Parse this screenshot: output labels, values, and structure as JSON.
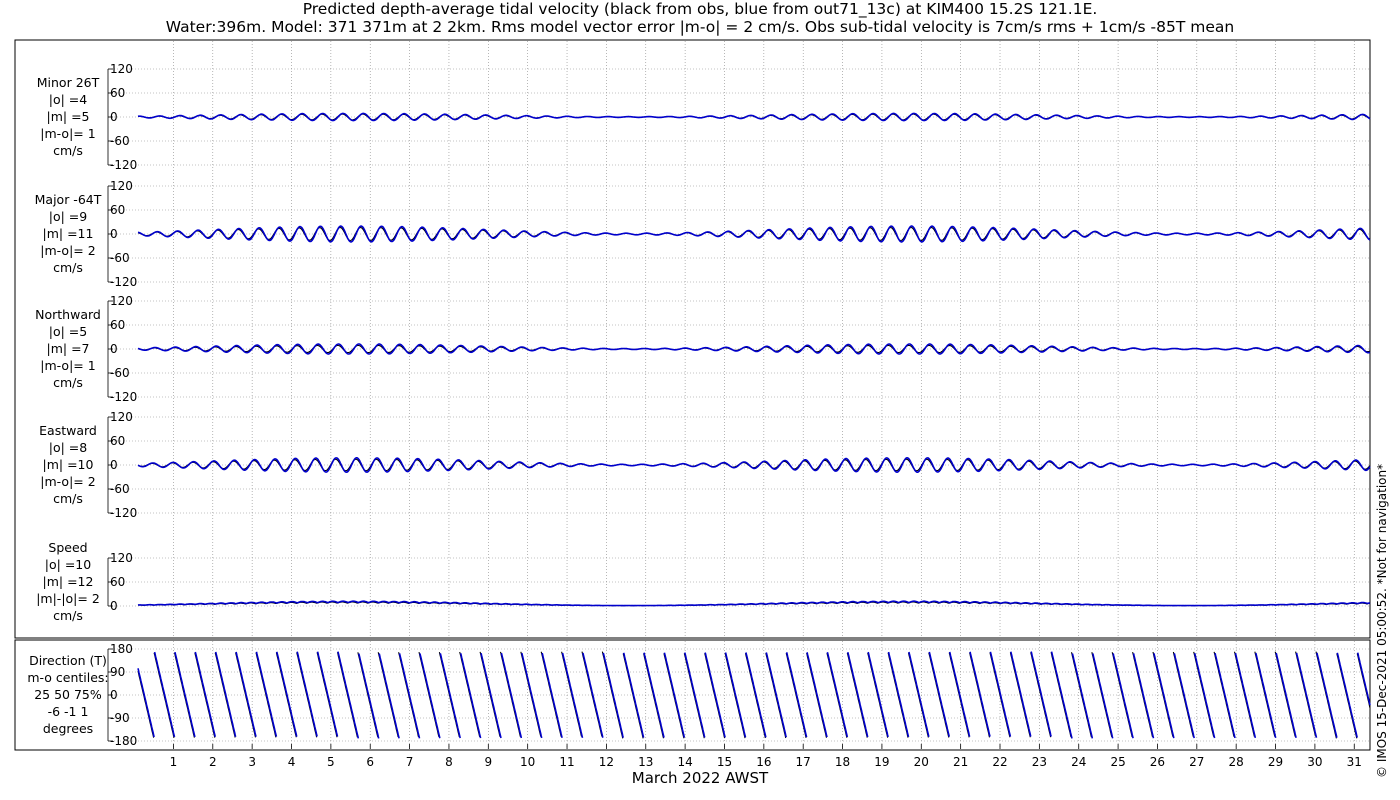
{
  "title_line1": "Predicted depth-average tidal velocity (black from obs, blue from out71_13c) at KIM400 15.2S 121.1E.",
  "title_line2": "Water:396m. Model: 371 371m at 2 2km. Rms model vector error |m-o| = 2 cm/s. Obs sub-tidal velocity is 7cm/s rms + 1cm/s -85T mean",
  "xlabel": "March 2022 AWST",
  "copyright": "© IMOS 15-Dec-2021 05:00:52. *Not for navigation*",
  "colors": {
    "obs": "#000000",
    "model": "#0000cc",
    "grid": "#888888"
  },
  "chart_data": {
    "type": "line",
    "x_ticks": [
      "1",
      "2",
      "3",
      "4",
      "5",
      "6",
      "7",
      "8",
      "9",
      "10",
      "11",
      "12",
      "13",
      "14",
      "15",
      "16",
      "17",
      "18",
      "19",
      "20",
      "21",
      "22",
      "23",
      "24",
      "25",
      "26",
      "27",
      "28",
      "29",
      "30",
      "31"
    ],
    "x_range": [
      0.1,
      31.4
    ],
    "grid": true,
    "series_names": [
      "obs",
      "out71_13c"
    ],
    "panels": [
      {
        "label": [
          "Minor 26T",
          "|o| =4",
          "|m| =5",
          "|m-o|= 1",
          "cm/s"
        ],
        "ylim": [
          -120,
          120
        ],
        "yticks": [
          "120",
          "60",
          "0",
          "-60",
          "-120"
        ],
        "amp_obs": 4,
        "amp_model": 5,
        "kind": "signed"
      },
      {
        "label": [
          "Major -64T",
          "|o| =9",
          "|m| =11",
          "|m-o|= 2",
          "cm/s"
        ],
        "ylim": [
          -120,
          120
        ],
        "yticks": [
          "120",
          "60",
          "0",
          "-60",
          "-120"
        ],
        "amp_obs": 9,
        "amp_model": 11,
        "kind": "signed"
      },
      {
        "label": [
          "Northward",
          "|o| =5",
          "|m| =7",
          "|m-o|= 1",
          "cm/s"
        ],
        "ylim": [
          -120,
          120
        ],
        "yticks": [
          "120",
          "60",
          "0",
          "-60",
          "-120"
        ],
        "amp_obs": 5,
        "amp_model": 7,
        "kind": "signed"
      },
      {
        "label": [
          "Eastward",
          "|o| =8",
          "|m| =10",
          "|m-o|= 2",
          "cm/s"
        ],
        "ylim": [
          -120,
          120
        ],
        "yticks": [
          "120",
          "60",
          "0",
          "-60",
          "-120"
        ],
        "amp_obs": 8,
        "amp_model": 10,
        "kind": "signed"
      },
      {
        "label": [
          "Speed",
          "|o| =10",
          "|m| =12",
          "|m|-|o|= 2",
          "cm/s"
        ],
        "ylim": [
          0,
          120
        ],
        "yticks": [
          "120",
          "60",
          "0"
        ],
        "amp_obs": 10,
        "amp_model": 12,
        "kind": "speed"
      },
      {
        "label": [
          "Direction (T)",
          "m-o centiles:",
          "25  50  75%",
          "-6 -1  1",
          "degrees"
        ],
        "ylim": [
          -180,
          180
        ],
        "yticks": [
          "180",
          "90",
          "0",
          "-90",
          "-180"
        ],
        "kind": "direction",
        "centiles": {
          "p25": -6,
          "p50": -1,
          "p75": 1
        }
      }
    ]
  }
}
